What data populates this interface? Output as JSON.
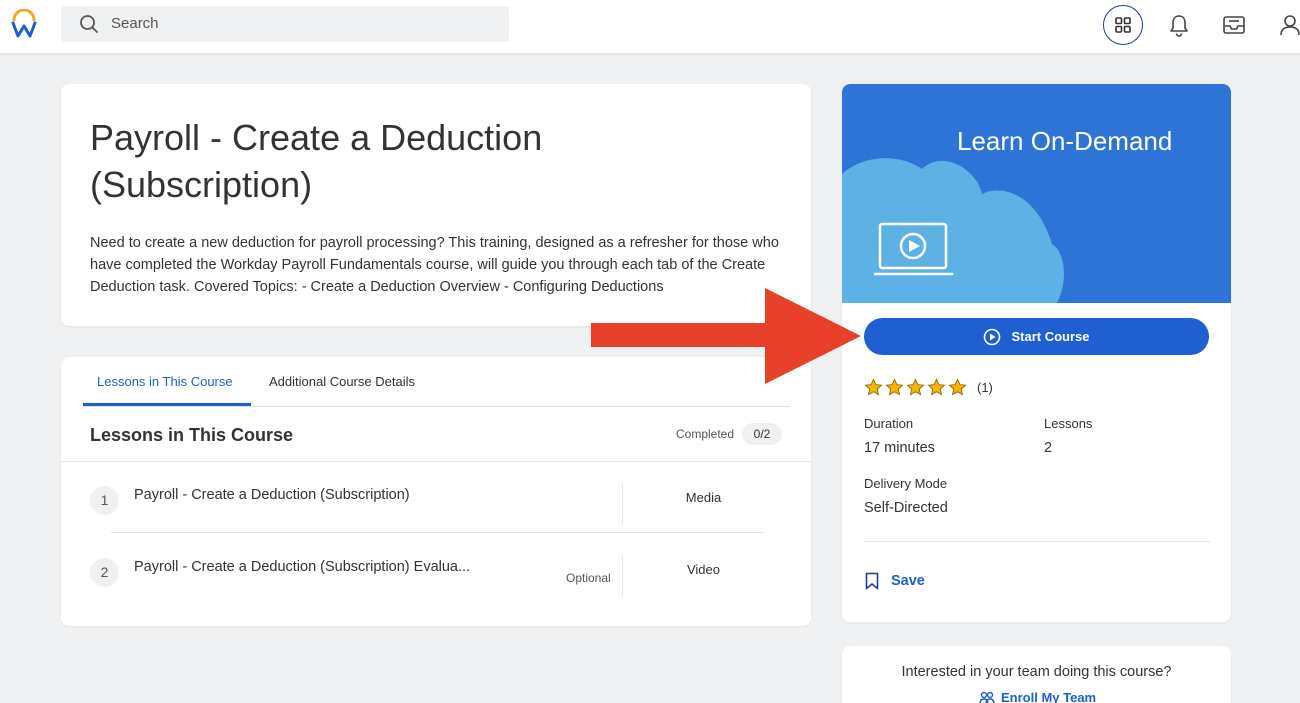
{
  "header": {
    "search_placeholder": "Search"
  },
  "course": {
    "title": "Payroll - Create a Deduction (Subscription)",
    "description": "Need to create a new deduction for payroll processing? This training, designed as a refresher for those who have completed the Workday Payroll Fundamentals course, will guide you through each tab of the Create Deduction task. Covered Topics: - Create a Deduction Overview - Configuring Deductions"
  },
  "tabs": [
    {
      "label": "Lessons in This Course",
      "active": true
    },
    {
      "label": "Additional Course Details",
      "active": false
    }
  ],
  "lessons": {
    "heading": "Lessons in This Course",
    "completed_label": "Completed",
    "completed_value": "0/2",
    "items": [
      {
        "number": "1",
        "name": "Payroll - Create a Deduction (Subscription)",
        "optional": "",
        "type": "Media"
      },
      {
        "number": "2",
        "name": "Payroll - Create a Deduction (Subscription) Evalua...",
        "optional": "Optional",
        "type": "Video"
      }
    ]
  },
  "side": {
    "banner_title": "Learn On-Demand",
    "start_label": "Start Course",
    "rating": 5,
    "rating_count": "(1)",
    "duration_label": "Duration",
    "duration_value": "17 minutes",
    "lessons_label": "Lessons",
    "lessons_value": "2",
    "delivery_label": "Delivery Mode",
    "delivery_value": "Self-Directed",
    "save_label": "Save"
  },
  "team": {
    "question": "Interested in your team doing this course?",
    "enroll_label": "Enroll My Team"
  },
  "colors": {
    "accent": "#1f5fd1",
    "banner": "#2e74d6",
    "cloud": "#5eb1e4",
    "star": "#f5b400",
    "arrow": "#e8402a"
  }
}
